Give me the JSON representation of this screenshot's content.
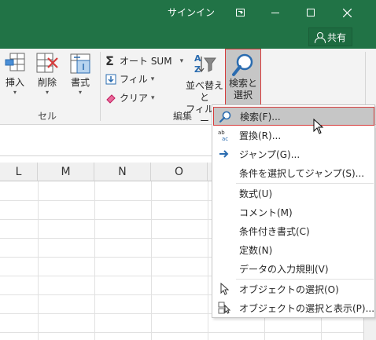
{
  "titlebar": {
    "signin_label": "サインイン",
    "share_label": "共有"
  },
  "ribbon": {
    "cells_group": {
      "insert_label": "挿入",
      "delete_label": "削除",
      "format_label": "書式",
      "group_label": "セル"
    },
    "editing_group": {
      "autosum_label": "オート SUM",
      "fill_label": "フィル",
      "clear_label": "クリア",
      "sort_label_line1": "並べ替えと",
      "sort_label_line2": "フィルター",
      "find_label_line1": "検索と",
      "find_label_line2": "選択",
      "group_label": "編集"
    }
  },
  "grid": {
    "columns": [
      "L",
      "M",
      "N",
      "O"
    ]
  },
  "find_menu": {
    "items": [
      {
        "label": "検索(F)...",
        "icon": "magnifier-icon",
        "highlighted": true
      },
      {
        "label": "置換(R)...",
        "icon": "replace-ab-ac-icon"
      },
      {
        "label": "ジャンプ(G)...",
        "icon": "arrow-right-icon"
      },
      {
        "label": "条件を選択してジャンプ(S)...",
        "icon": ""
      },
      {
        "label": "数式(U)",
        "icon": ""
      },
      {
        "label": "コメント(M)",
        "icon": ""
      },
      {
        "label": "条件付き書式(C)",
        "icon": ""
      },
      {
        "label": "定数(N)",
        "icon": ""
      },
      {
        "label": "データの入力規則(V)",
        "icon": ""
      },
      {
        "label": "オブジェクトの選択(O)",
        "icon": "pointer-icon"
      },
      {
        "label": "オブジェクトの選択と表示(P)...",
        "icon": "selection-pane-icon"
      }
    ]
  },
  "colors": {
    "title_green": "#217346",
    "highlight_border": "#d63a3a",
    "ribbon_bg": "#f3f3f3"
  }
}
